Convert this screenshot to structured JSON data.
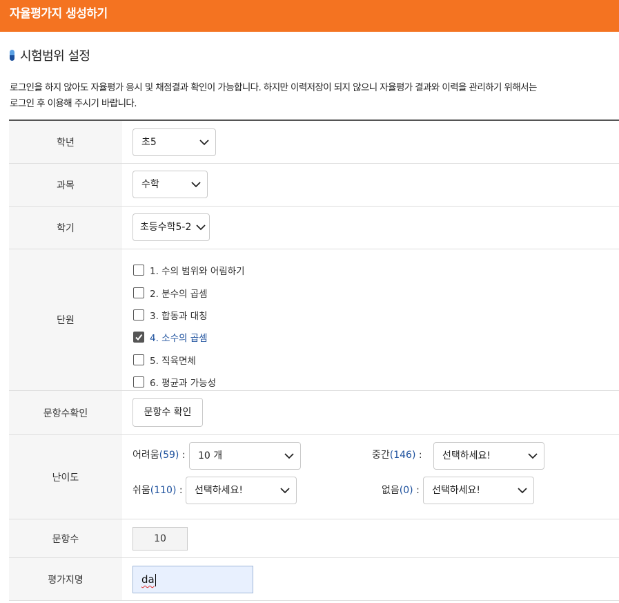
{
  "header": {
    "title": "자율평가지 생성하기"
  },
  "section": {
    "title": "시험범위 설정"
  },
  "notice": {
    "line1": "로그인을 하지 않아도 자율평가 응시 및 채점결과 확인이 가능합니다. 하지만 이력저장이 되지 않으니 자율평가 결과와 이력을 관리하기 위해서는",
    "line2": "로그인 후 이용해 주시기 바랍니다."
  },
  "form": {
    "grade": {
      "label": "학년",
      "value": "초5"
    },
    "subject": {
      "label": "과목",
      "value": "수학"
    },
    "semester": {
      "label": "학기",
      "value": "초등수학5-2"
    },
    "units": {
      "label": "단원",
      "items": [
        {
          "label": "1. 수의 범위와 어림하기",
          "checked": false
        },
        {
          "label": "2. 분수의 곱셈",
          "checked": false
        },
        {
          "label": "3. 합동과 대칭",
          "checked": false
        },
        {
          "label": "4. 소수의 곱셈",
          "checked": true
        },
        {
          "label": "5. 직육면체",
          "checked": false
        },
        {
          "label": "6. 평균과 가능성",
          "checked": false
        }
      ]
    },
    "question_check": {
      "label": "문항수확인",
      "button": "문항수 확인"
    },
    "difficulty": {
      "label": "난이도",
      "hard": {
        "name": "어려움",
        "count": "(59)",
        "sep": ":",
        "value": "10 개"
      },
      "medium": {
        "name": "중간",
        "count": "(146)",
        "sep": ":",
        "value": "선택하세요!"
      },
      "easy": {
        "name": "쉬움",
        "count": "(110)",
        "sep": ":",
        "value": "선택하세요!"
      },
      "none": {
        "name": "없음",
        "count": "(0)",
        "sep": ":",
        "value": "선택하세요!"
      }
    },
    "question_count": {
      "label": "문항수",
      "value": "10"
    },
    "exam_name": {
      "label": "평가지명",
      "value": "da"
    }
  },
  "icons": {
    "select_arrow": "chevron-down-icon",
    "check": "checkmark-icon",
    "bullet": "pill-bullet-icon"
  },
  "colors": {
    "header": "#f47321",
    "accent": "#1b4f9c",
    "label_bg": "#f6f6f6"
  }
}
